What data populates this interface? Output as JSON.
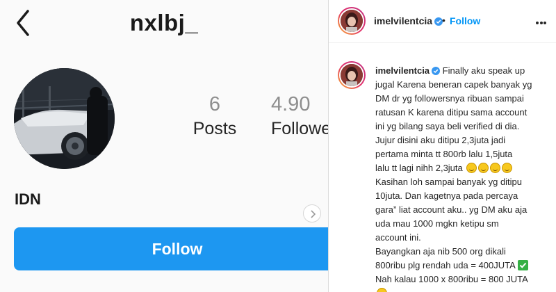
{
  "profile": {
    "username": "nxlbj_",
    "name": "IDN",
    "stats": [
      {
        "value": "6",
        "label": "Posts"
      },
      {
        "value": "4.90",
        "label": "Followe"
      }
    ],
    "follow_label": "Follow"
  },
  "post": {
    "author": "imelvilentcia",
    "separator": "•",
    "follow_label": "Follow",
    "caption_lines": [
      "Finally aku speak up",
      "jugal Karena beneran capek banyak yg",
      "DM dr yg followersnya ribuan sampai",
      "ratusan K karena ditipu sama account",
      "ini yg bilang saya beli verified di dia.",
      "Jujur disini aku ditipu 2,3juta jadi",
      "pertama minta tt 800rb lalu 1,5juta",
      "lalu tt lagi nihh 2,3juta",
      "Kasihan loh sampai banyak yg ditipu",
      "10juta. Dan kagetnya pada percaya",
      "gara” liat account aku.. yg DM aku aja",
      "uda mau 1000 mgkn ketipu sm",
      "account ini.",
      "Bayangkan aja nib 500 org dikali",
      "800ribu plg rendah uda = 400JUTA",
      "Nah kalau 1000 x 800ribu = 800 JUTA"
    ]
  },
  "colors": {
    "follow_blue": "#1d97f1",
    "link_blue": "#0095f6",
    "verified_blue": "#3897f0"
  },
  "icons": [
    "back-arrow-icon",
    "chevron-right-icon",
    "verified-badge-icon",
    "more-options-icon",
    "rofl-emoji-icon",
    "check-mark-emoji-icon",
    "grimace-emoji-icon"
  ]
}
